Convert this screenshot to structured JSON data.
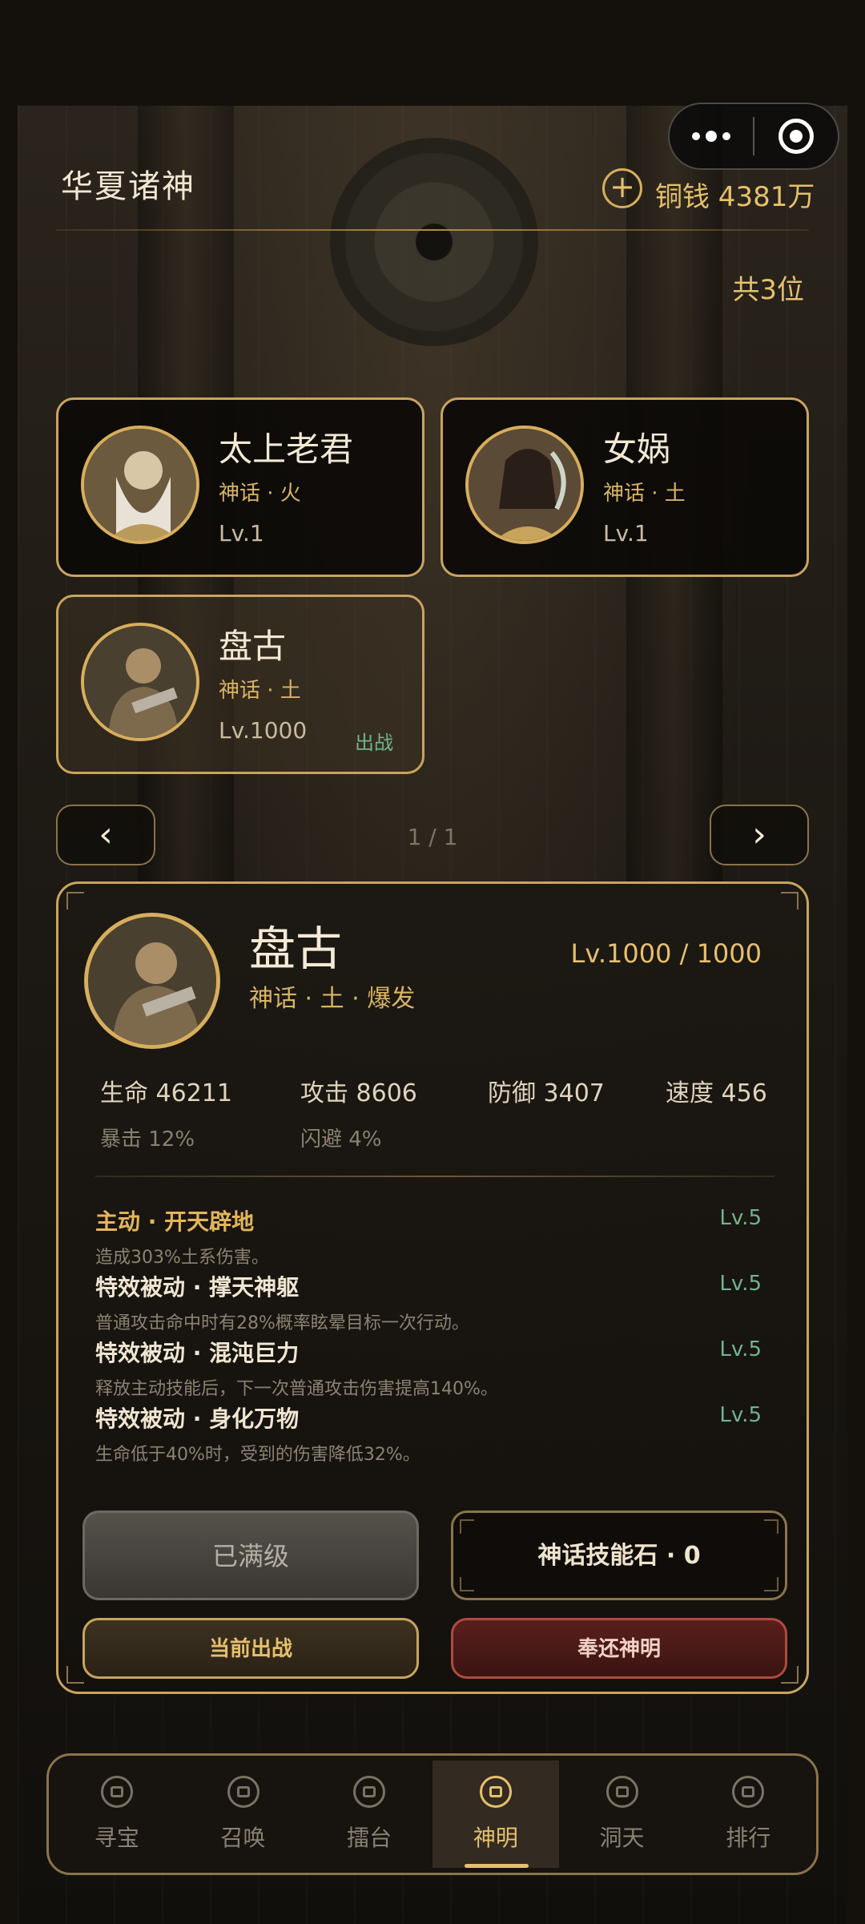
{
  "header": {
    "title": "华夏诸神",
    "currency_add_icon": "plus-circle-icon",
    "currency_label": "铜钱 4381万",
    "total_count": "共3位"
  },
  "heroes": [
    {
      "name": "太上老君",
      "tags": "神话 · 火",
      "level": "Lv.1",
      "status": ""
    },
    {
      "name": "女娲",
      "tags": "神话 · 土",
      "level": "Lv.1",
      "status": ""
    },
    {
      "name": "盘古",
      "tags": "神话 · 土",
      "level": "Lv.1000",
      "status": "出战"
    }
  ],
  "pager": {
    "prev": "‹",
    "next": "›",
    "indicator": "1 / 1"
  },
  "detail": {
    "name": "盘古",
    "tags": "神话 · 土 · 爆发",
    "level": "Lv.1000 / 1000",
    "stats": {
      "hp": "生命 46211",
      "atk": "攻击 8606",
      "def": "防御 3407",
      "spd": "速度 456",
      "crit": "暴击 12%",
      "dodge": "闪避 4%"
    },
    "skills": [
      {
        "name": "主动 · 开天辟地",
        "desc": "造成303%土系伤害。",
        "level": "Lv.5"
      },
      {
        "name": "特效被动 · 撑天神躯",
        "desc": "普通攻击命中时有28%概率眩晕目标一次行动。",
        "level": "Lv.5"
      },
      {
        "name": "特效被动 · 混沌巨力",
        "desc": "释放主动技能后，下一次普通攻击伤害提高140%。",
        "level": "Lv.5"
      },
      {
        "name": "特效被动 · 身化万物",
        "desc": "生命低于40%时，受到的伤害降低32%。",
        "level": "Lv.5"
      }
    ],
    "buttons": {
      "maxed": "已满级",
      "skill_stone": "神话技能石 · 0",
      "current_deploy": "当前出战",
      "return": "奉还神明"
    }
  },
  "nav": [
    {
      "label": "寻宝",
      "icon": "treasure-icon",
      "active": false
    },
    {
      "label": "召唤",
      "icon": "summon-icon",
      "active": false
    },
    {
      "label": "擂台",
      "icon": "arena-icon",
      "active": false
    },
    {
      "label": "神明",
      "icon": "deity-icon",
      "active": true
    },
    {
      "label": "洞天",
      "icon": "cave-icon",
      "active": false
    },
    {
      "label": "排行",
      "icon": "ranking-icon",
      "active": false
    }
  ]
}
